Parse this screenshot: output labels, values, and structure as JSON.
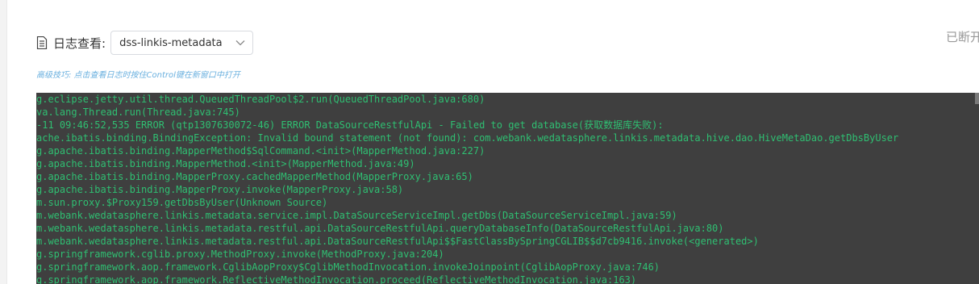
{
  "header": {
    "label": "日志查看:",
    "selected_service": "dss-linkis-metadata"
  },
  "status": "已断开",
  "tip": "高级技巧: 点击查看日志时按住Control键在新窗口中打开",
  "log_lines": [
    "g.eclipse.jetty.util.thread.QueuedThreadPool$2.run(QueuedThreadPool.java:680)",
    "va.lang.Thread.run(Thread.java:745)",
    "-11 09:46:52,535 ERROR (qtp1307630072-46) ERROR DataSourceRestfulApi - Failed to get database(获取数据库失败):",
    "ache.ibatis.binding.BindingException: Invalid bound statement (not found): com.webank.wedatasphere.linkis.metadata.hive.dao.HiveMetaDao.getDbsByUser",
    "g.apache.ibatis.binding.MapperMethod$SqlCommand.<init>(MapperMethod.java:227)",
    "g.apache.ibatis.binding.MapperMethod.<init>(MapperMethod.java:49)",
    "g.apache.ibatis.binding.MapperProxy.cachedMapperMethod(MapperProxy.java:65)",
    "g.apache.ibatis.binding.MapperProxy.invoke(MapperProxy.java:58)",
    "m.sun.proxy.$Proxy159.getDbsByUser(Unknown Source)",
    "m.webank.wedatasphere.linkis.metadata.service.impl.DataSourceServiceImpl.getDbs(DataSourceServiceImpl.java:59)",
    "m.webank.wedatasphere.linkis.metadata.restful.api.DataSourceRestfulApi.queryDatabaseInfo(DataSourceRestfulApi.java:80)",
    "m.webank.wedatasphere.linkis.metadata.restful.api.DataSourceRestfulApi$$FastClassBySpringCGLIB$$d7cb9416.invoke(<generated>)",
    "g.springframework.cglib.proxy.MethodProxy.invoke(MethodProxy.java:204)",
    "g.springframework.aop.framework.CglibAopProxy$CglibMethodInvocation.invokeJoinpoint(CglibAopProxy.java:746)",
    "g.springframework.aop.framework.ReflectiveMethodInvocation.proceed(ReflectiveMethodInvocation.java:163)"
  ],
  "colors": {
    "console_bg": "#3f3f3f",
    "log_text": "#2fbf72",
    "tip_text": "#6ab0df"
  },
  "icons": {
    "header": "document-icon",
    "select": "chevron-down-icon"
  }
}
